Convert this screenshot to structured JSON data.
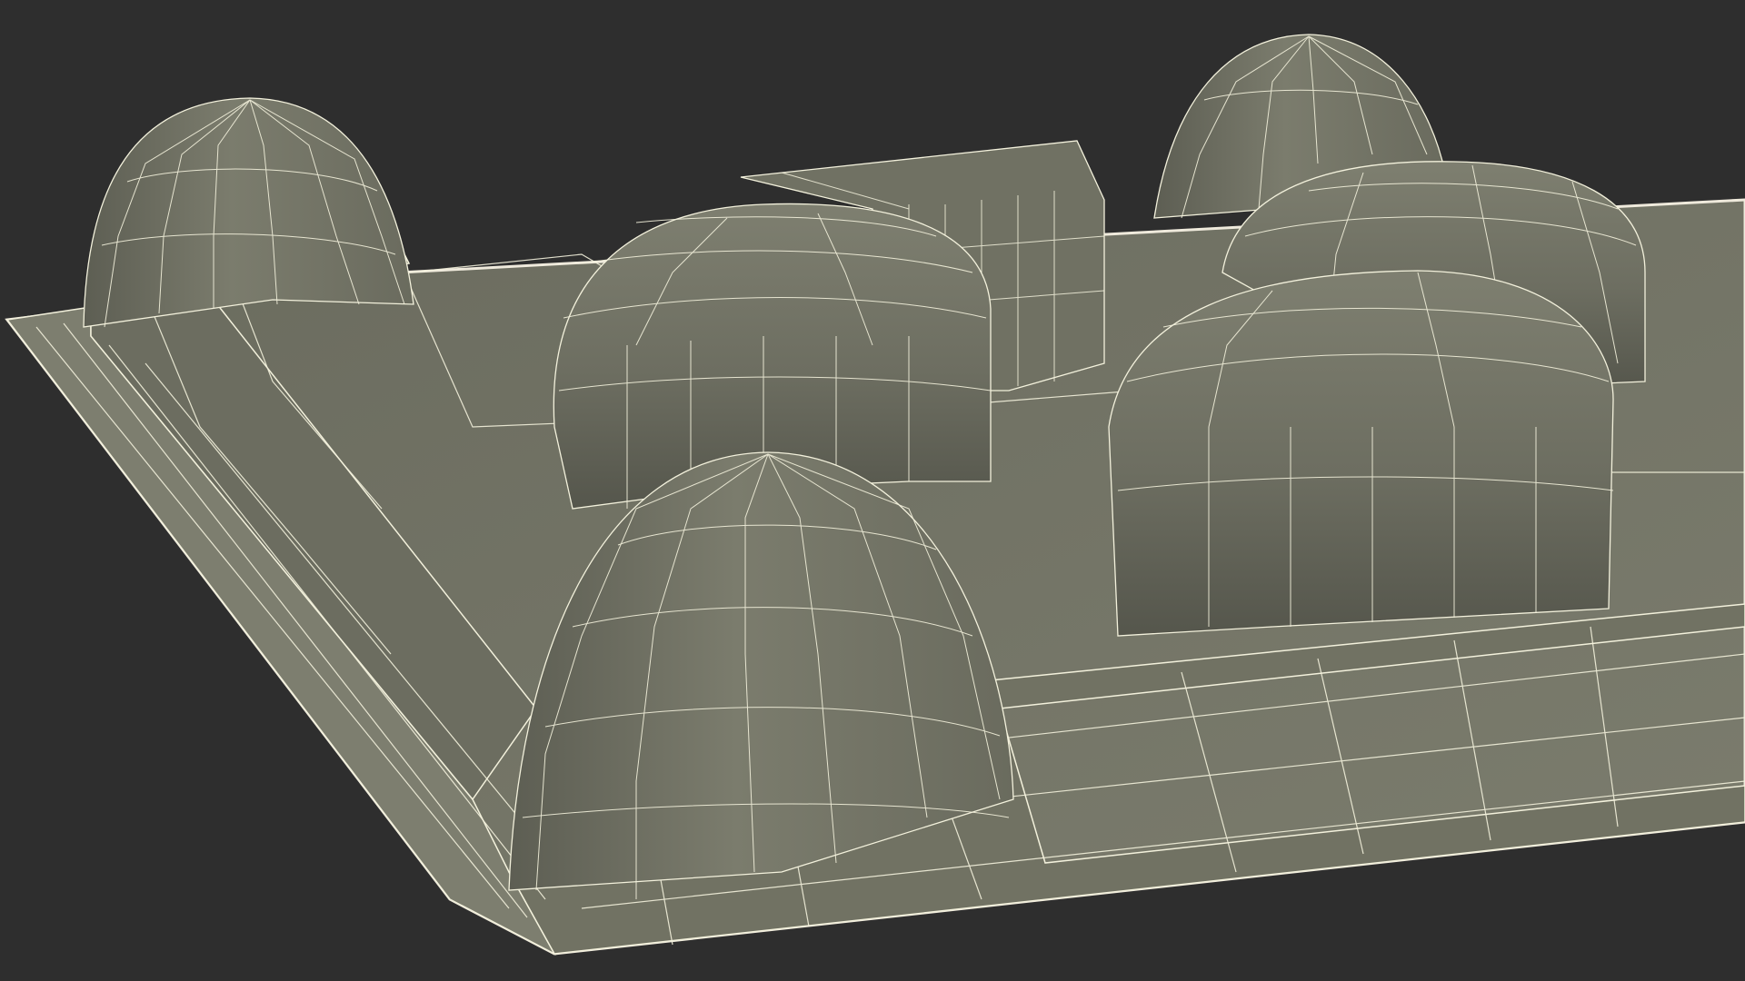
{
  "scene": {
    "background_color": "#2e2e2e",
    "surface_color": "#767768",
    "surface_shadow_color": "#5a5b50",
    "surface_highlight_color": "#8a8b7c",
    "wire_color": "#f3f1dc",
    "edge_color": "#efeadc",
    "subject": "wireframe-tray-mesh"
  }
}
